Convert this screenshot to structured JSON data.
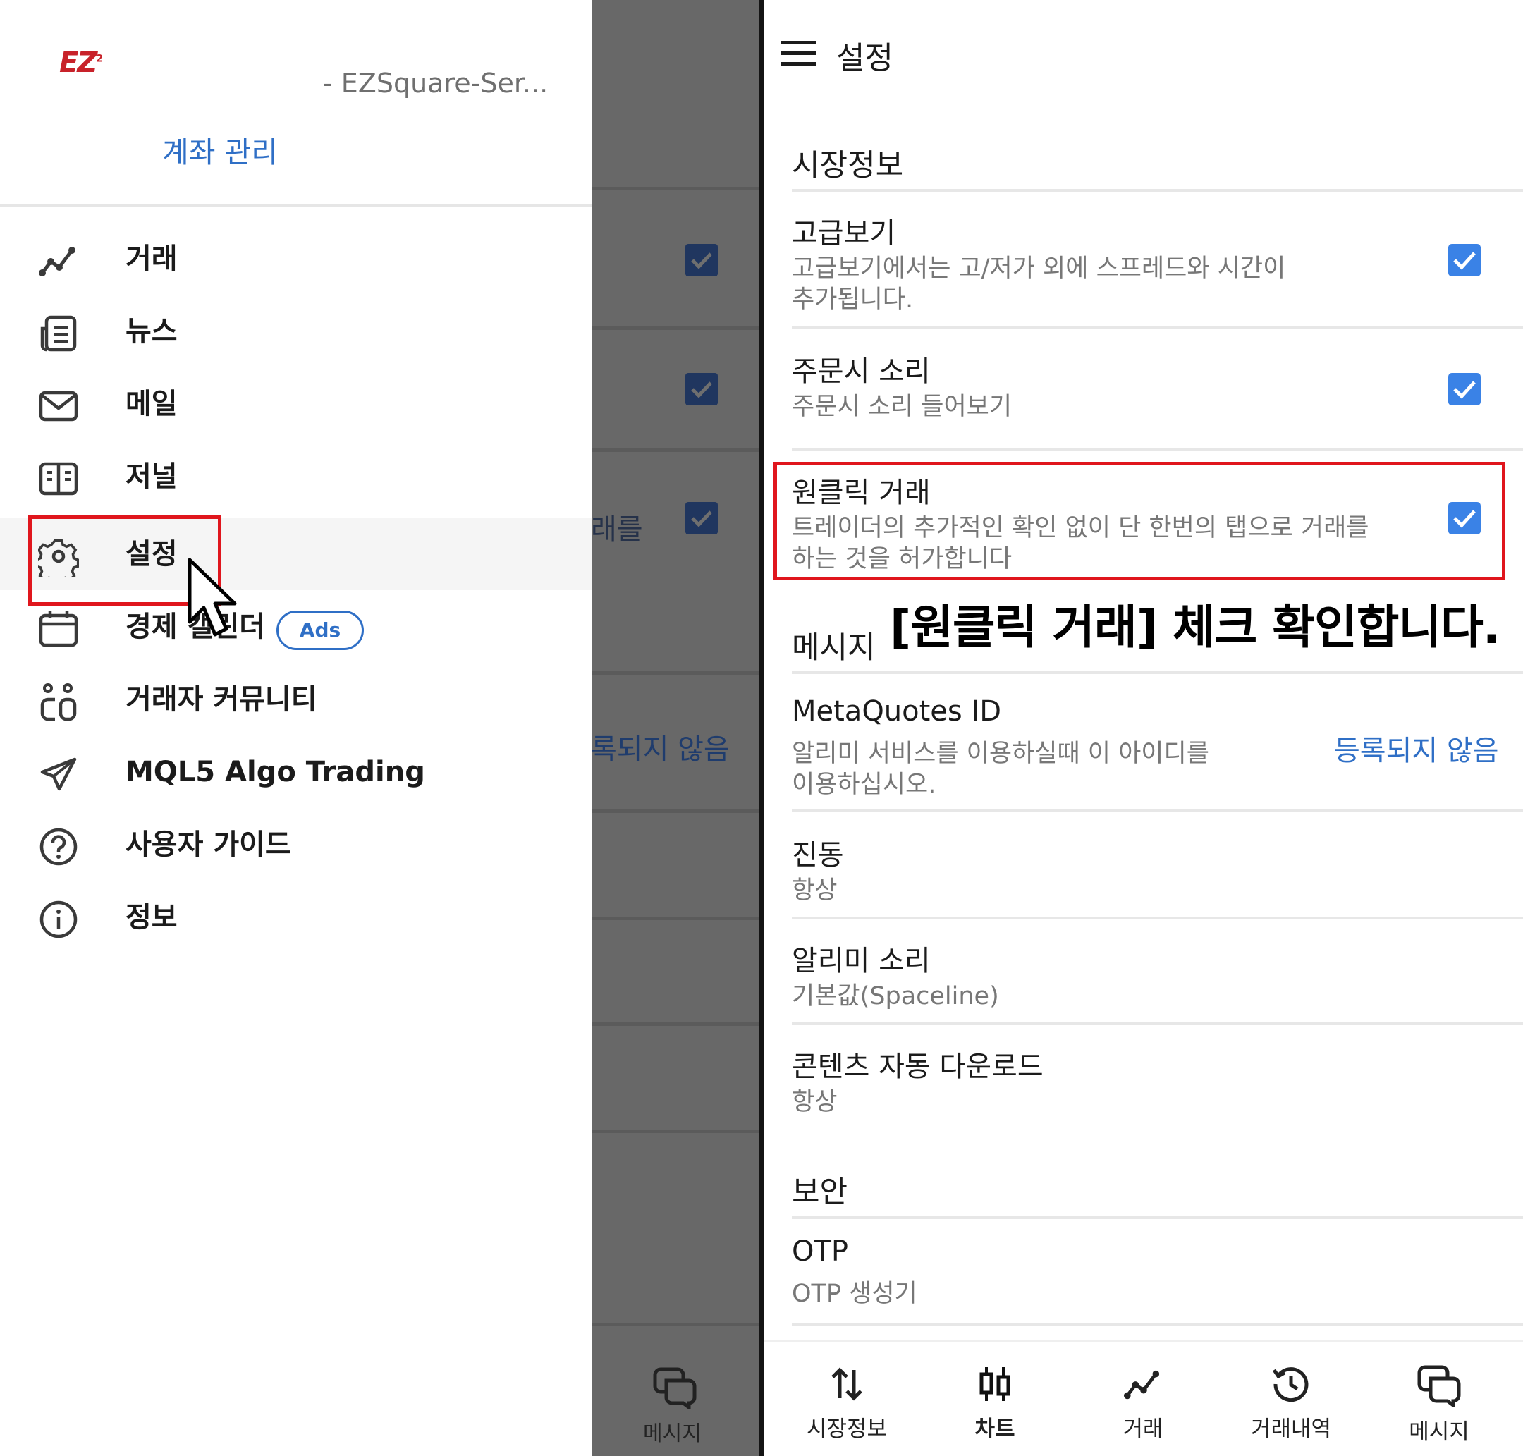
{
  "drawer": {
    "logo_text": "EZ",
    "logo_sup": "2",
    "server": "- EZSquare-Ser...",
    "account_link": "계좌 관리",
    "items": [
      {
        "label": "거래",
        "icon": "trade-line-icon"
      },
      {
        "label": "뉴스",
        "icon": "news-icon"
      },
      {
        "label": "메일",
        "icon": "mail-icon"
      },
      {
        "label": "저널",
        "icon": "journal-icon"
      },
      {
        "label": "설정",
        "icon": "gear-icon"
      },
      {
        "label": "경제 캘린더",
        "icon": "calendar-icon",
        "badge": "Ads"
      },
      {
        "label": "거래자 커뮤니티",
        "icon": "community-icon"
      },
      {
        "label": "MQL5 Algo Trading",
        "icon": "send-icon"
      },
      {
        "label": "사용자 가이드",
        "icon": "help-icon"
      },
      {
        "label": "정보",
        "icon": "info-icon"
      }
    ]
  },
  "overlay": {
    "partial_text_1": "래를",
    "partial_text_2": "록되지 않음",
    "nav_label": "메시지"
  },
  "settings": {
    "title": "설정",
    "sections": {
      "market": "시장정보",
      "messages": "메시지",
      "security": "보안"
    },
    "advanced_view": {
      "title": "고급보기",
      "desc_line1": "고급보기에서는 고/저가 외에 스프레드와 시간이",
      "desc_line2": "추가됩니다.",
      "checked": true
    },
    "order_sound": {
      "title": "주문시 소리",
      "desc": "주문시 소리 들어보기",
      "checked": true
    },
    "one_click": {
      "title": "원클릭 거래",
      "desc_line1": "트레이더의 추가적인 확인 없이 단 한번의 탭으로 거래를",
      "desc_line2": "하는 것을 허가합니다",
      "checked": true
    },
    "annotation": "[원클릭 거래] 체크 확인합니다.",
    "metaquotes": {
      "title": "MetaQuotes ID",
      "desc_line1": "알리미 서비스를 이용하실때 이 아이디를",
      "desc_line2": "이용하십시오.",
      "action": "등록되지 않음"
    },
    "vibration": {
      "title": "진동",
      "value": "항상"
    },
    "notify_sound": {
      "title": "알리미 소리",
      "value": "기본값(Spaceline)"
    },
    "auto_download": {
      "title": "콘텐츠 자동 다운로드",
      "value": "항상"
    },
    "otp": {
      "title": "OTP",
      "value": "OTP 생성기"
    },
    "accent_color": "#3a82e6"
  },
  "bottom_nav": [
    {
      "label": "시장정보",
      "icon": "quotes-arrows-icon"
    },
    {
      "label": "차트",
      "icon": "chart-candles-icon",
      "active": true
    },
    {
      "label": "거래",
      "icon": "trade-line-icon"
    },
    {
      "label": "거래내역",
      "icon": "history-icon"
    },
    {
      "label": "메시지",
      "icon": "messages-icon"
    }
  ]
}
